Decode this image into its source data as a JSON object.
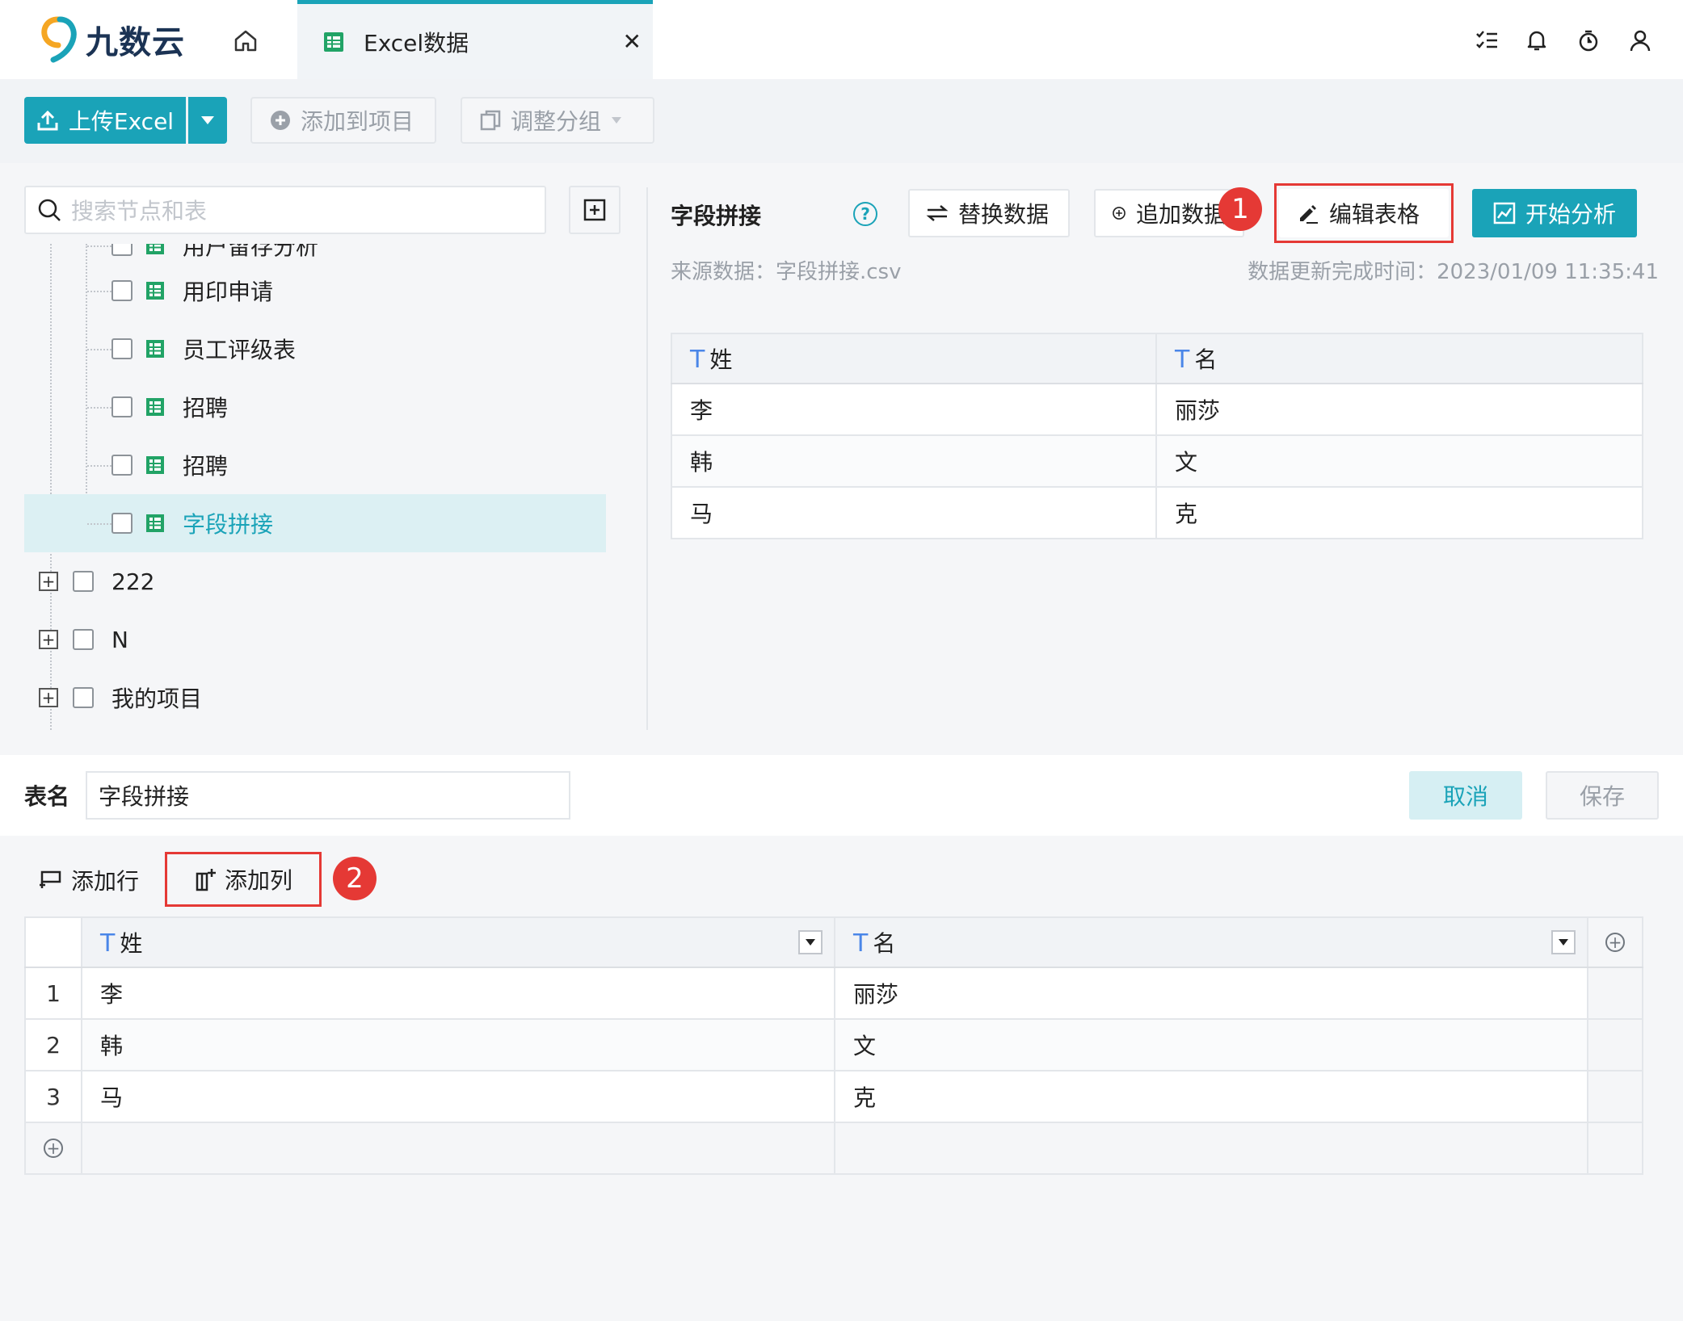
{
  "app": {
    "name": "九数云"
  },
  "tab": {
    "label": "Excel数据"
  },
  "toolbar": {
    "upload_label": "上传Excel",
    "add_to_project_label": "添加到项目",
    "adjust_group_label": "调整分组"
  },
  "search": {
    "placeholder": "搜索节点和表"
  },
  "tree": {
    "children": [
      "用户留存分析",
      "用印申请",
      "员工评级表",
      "招聘",
      "招聘",
      "字段拼接"
    ],
    "folders": [
      "222",
      "N",
      "我的项目"
    ]
  },
  "detail": {
    "title": "字段拼接",
    "help": "?",
    "replace_label": "替换数据",
    "append_label": "追加数据",
    "edit_label": "编辑表格",
    "analyze_label": "开始分析",
    "source": "来源数据：字段拼接.csv",
    "updated": "数据更新完成时间：2023/01/09 11:35:41",
    "badge1": "1",
    "columns": [
      "姓",
      "名"
    ],
    "rows": [
      [
        "李",
        "丽莎"
      ],
      [
        "韩",
        "文"
      ],
      [
        "马",
        "克"
      ]
    ]
  },
  "editor": {
    "name_label": "表名",
    "name_value": "字段拼接",
    "cancel_label": "取消",
    "save_label": "保存",
    "add_row_label": "添加行",
    "add_col_label": "添加列",
    "badge2": "2",
    "columns": [
      "姓",
      "名"
    ],
    "row_numbers": [
      "1",
      "2",
      "3"
    ],
    "rows": [
      [
        "李",
        "丽莎"
      ],
      [
        "韩",
        "文"
      ],
      [
        "马",
        "克"
      ]
    ]
  },
  "colors": {
    "accent": "#1aa3b8",
    "highlight": "#e53935",
    "excel_green": "#21a366"
  },
  "icons": [
    "home-icon",
    "excel-icon",
    "close-icon",
    "list-icon",
    "bell-icon",
    "timer-icon",
    "user-icon",
    "upload-icon",
    "plus-circle-icon",
    "copy-icon",
    "search-icon",
    "swap-icon",
    "edit-icon",
    "chart-icon",
    "add-row-icon",
    "add-col-icon",
    "caret-down-icon"
  ]
}
